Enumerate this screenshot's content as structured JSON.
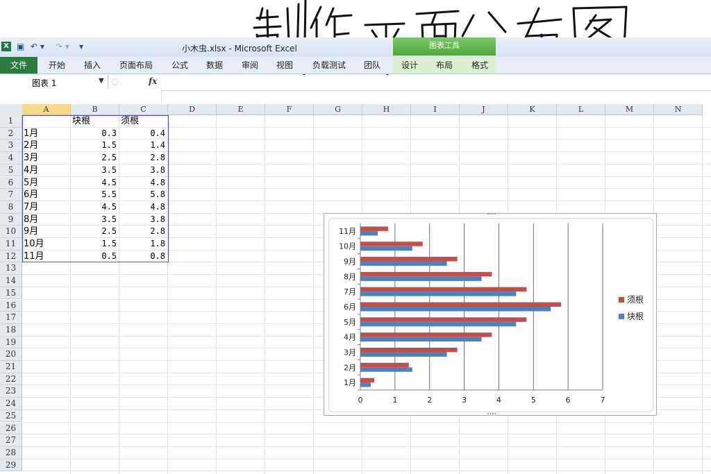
{
  "window": {
    "title": "小木虫.xlsx  -  Microsoft Excel",
    "app_icon": "excel-icon",
    "context_tab_title": "图表工具"
  },
  "quick_access": {
    "save": "save-icon",
    "undo": "undo-icon",
    "redo": "redo-icon",
    "customize": "customize-icon"
  },
  "ribbon": {
    "file_tab": "文件",
    "tabs": [
      "开始",
      "插入",
      "页面布局",
      "公式",
      "数据",
      "审阅",
      "视图",
      "负载测试",
      "团队"
    ],
    "context_tabs": [
      "设计",
      "布局",
      "格式"
    ]
  },
  "formula_bar": {
    "name_box": "图表 1",
    "fx": "fx",
    "formula": ""
  },
  "sheet": {
    "columns": [
      "A",
      "B",
      "C",
      "D",
      "E",
      "F",
      "G",
      "H",
      "I",
      "J",
      "K",
      "L",
      "M",
      "N"
    ],
    "rows": [
      "1",
      "2",
      "3",
      "4",
      "5",
      "6",
      "7",
      "8",
      "9",
      "10",
      "11",
      "12",
      "13",
      "14",
      "15",
      "16",
      "17",
      "18",
      "19",
      "20",
      "21",
      "22",
      "23",
      "24",
      "25",
      "26",
      "27",
      "28",
      "29"
    ],
    "headers": [
      "",
      "块根",
      "须根"
    ],
    "data": [
      [
        "1月",
        "0.3",
        "0.4"
      ],
      [
        "2月",
        "1.5",
        "1.4"
      ],
      [
        "3月",
        "2.5",
        "2.8"
      ],
      [
        "4月",
        "3.5",
        "3.8"
      ],
      [
        "5月",
        "4.5",
        "4.8"
      ],
      [
        "6月",
        "5.5",
        "5.8"
      ],
      [
        "7月",
        "4.5",
        "4.8"
      ],
      [
        "8月",
        "3.5",
        "3.8"
      ],
      [
        "9月",
        "2.5",
        "2.8"
      ],
      [
        "10月",
        "1.5",
        "1.8"
      ],
      [
        "11月",
        "0.5",
        "0.8"
      ]
    ]
  },
  "chart_data": {
    "type": "bar",
    "orientation": "horizontal",
    "categories": [
      "1月",
      "2月",
      "3月",
      "4月",
      "5月",
      "6月",
      "7月",
      "8月",
      "9月",
      "10月",
      "11月"
    ],
    "series": [
      {
        "name": "块根",
        "values": [
          0.3,
          1.5,
          2.5,
          3.5,
          4.5,
          5.5,
          4.5,
          3.5,
          2.5,
          1.5,
          0.5
        ],
        "color": "#4f81bd"
      },
      {
        "name": "须根",
        "values": [
          0.4,
          1.4,
          2.8,
          3.8,
          4.8,
          5.8,
          4.8,
          3.8,
          2.8,
          1.8,
          0.8
        ],
        "color": "#c0504d"
      }
    ],
    "xlim": [
      0,
      7
    ],
    "xticks": [
      "0",
      "1",
      "2",
      "3",
      "4",
      "5",
      "6",
      "7"
    ],
    "grid": "vertical",
    "legend": "right",
    "legend_order": [
      "须根",
      "块根"
    ]
  },
  "handwriting": "制作平面分布图"
}
